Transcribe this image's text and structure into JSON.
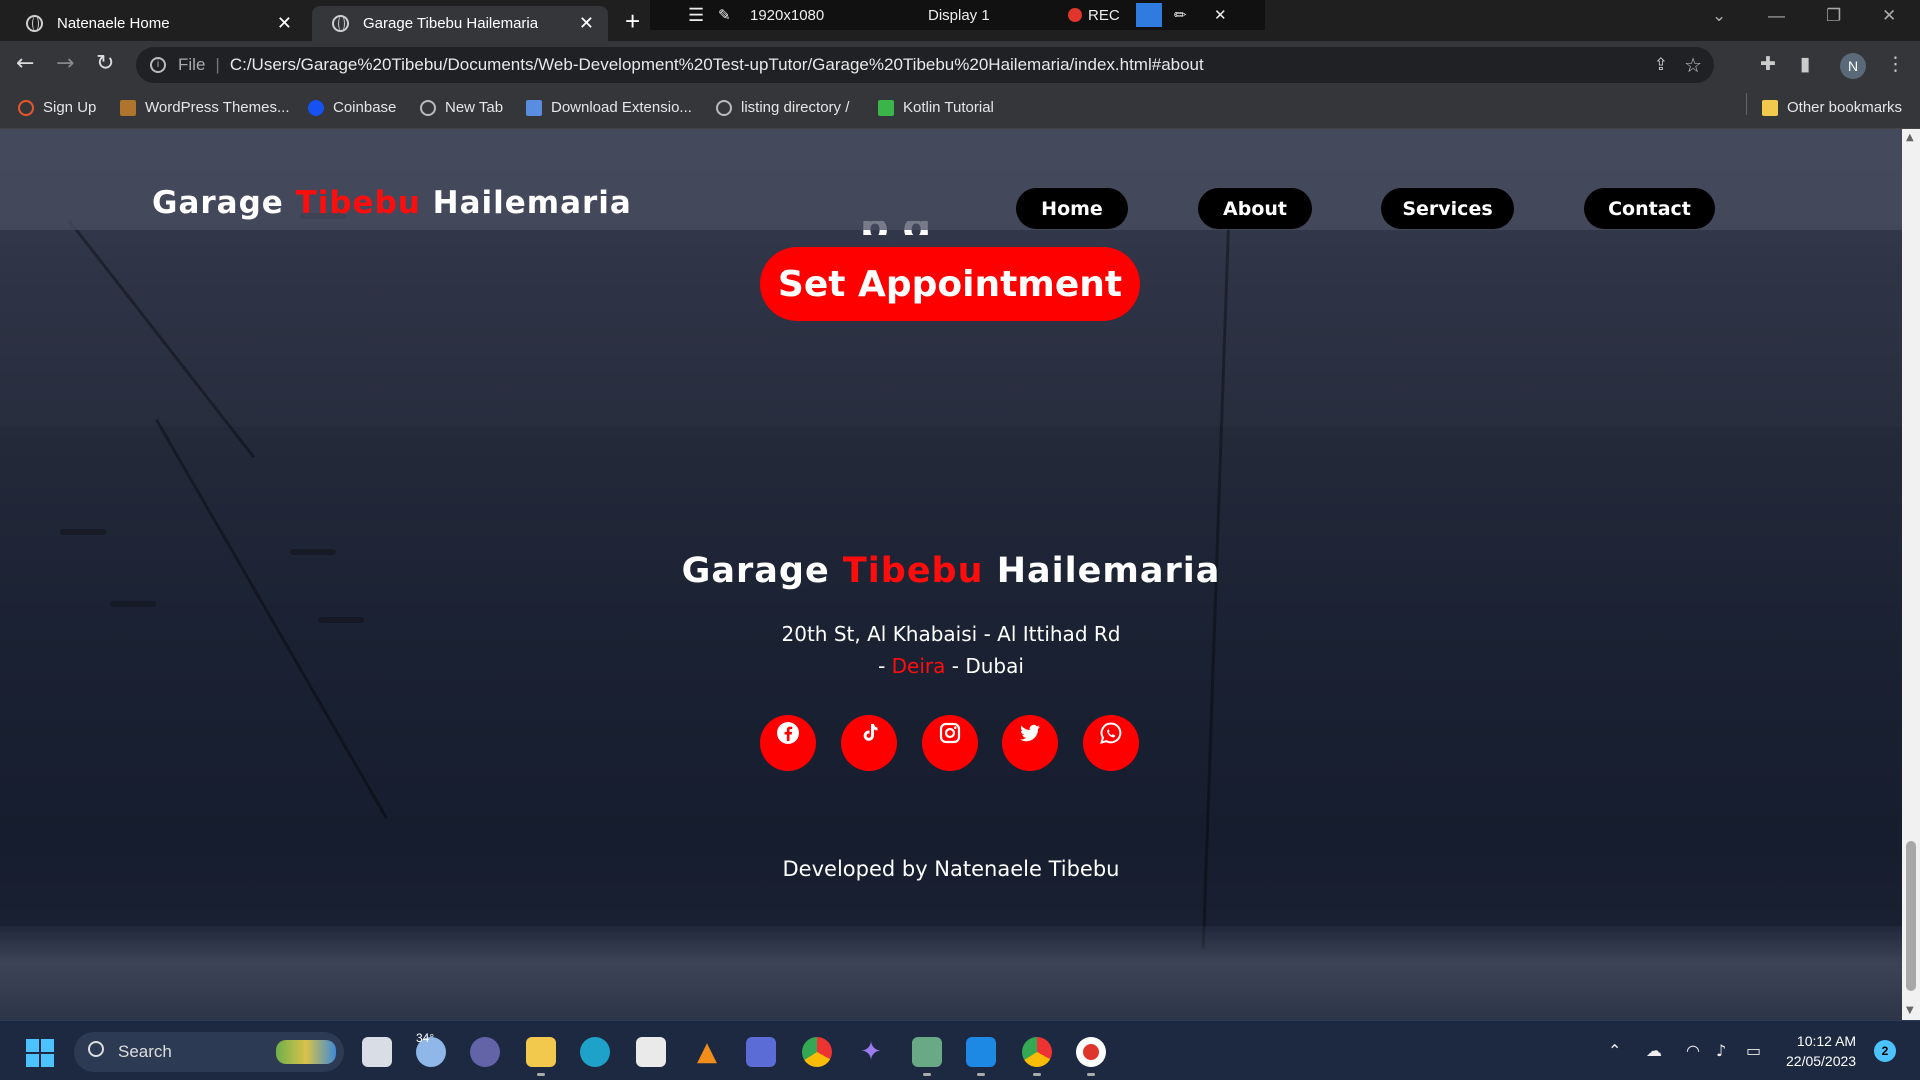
{
  "browser": {
    "tabs": [
      {
        "label": "Natenaele Home"
      },
      {
        "label": "Garage Tibebu Hailemaria"
      }
    ],
    "new_tab": "+",
    "recorder": {
      "resolution": "1920x1080",
      "display": "Display 1",
      "rec": "REC"
    },
    "address": {
      "scheme": "File",
      "url": "C:/Users/Garage%20Tibebu/Documents/Web-Development%20Test-upTutor/Garage%20Tibebu%20Hailemaria/index.html#about"
    },
    "profile_initial": "N",
    "bookmarks": [
      {
        "label": "Sign Up",
        "color": "#e8562a"
      },
      {
        "label": "WordPress Themes...",
        "color": "#b0752c"
      },
      {
        "label": "Coinbase",
        "color": "#1652f0"
      },
      {
        "label": "New Tab",
        "color": "#bbbbbb"
      },
      {
        "label": "Download Extensio...",
        "color": "#5a8de0"
      },
      {
        "label": "listing directory /",
        "color": "#bbbbbb"
      },
      {
        "label": "Kotlin Tutorial",
        "color": "#3bb44a"
      }
    ],
    "other_bookmarks": "Other bookmarks"
  },
  "site": {
    "logo": {
      "part1": "Garage",
      "part2": "Tibebu",
      "part3": "Hailemaria"
    },
    "nav": [
      {
        "label": "Home"
      },
      {
        "label": "About"
      },
      {
        "label": "Services"
      },
      {
        "label": "Contact"
      }
    ],
    "cta": "Set Appointment",
    "footer": {
      "title": {
        "part1": "Garage",
        "part2": "Tibebu",
        "part3": "Hailemaria"
      },
      "address_line1": "20th St, Al Khabaisi - Al Ittihad Rd",
      "address_line2_prefix": "-",
      "address_line2_highlight": "Deira",
      "address_line2_suffix": "- Dubai",
      "socials": [
        "facebook",
        "tiktok",
        "instagram",
        "twitter",
        "whatsapp"
      ],
      "credit": "Developed by Natenaele Tibebu"
    },
    "accent_color": "#ff0000"
  },
  "taskbar": {
    "search_label": "Search",
    "weather_temp": "34°",
    "time": "10:12 AM",
    "date": "22/05/2023",
    "notifications": "2"
  }
}
